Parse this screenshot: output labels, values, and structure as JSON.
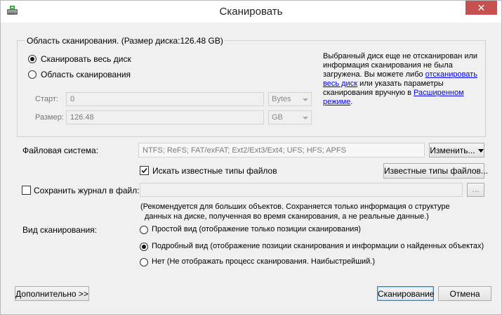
{
  "window": {
    "title": "Сканировать",
    "close_glyph": "✕"
  },
  "scan_area": {
    "group_title": "Область сканирования. (Размер диска:126.48 GB)",
    "radio_whole_disk": "Сканировать весь диск",
    "radio_area": "Область сканирования",
    "start_label": "Старт:",
    "start_value": "0",
    "start_unit": "Bytes",
    "size_label": "Размер:",
    "size_value": "126.48",
    "size_unit": "GB",
    "info_part1": "Выбранный диск еще не отсканирован или информация сканирования не была загружена. Вы можете либо ",
    "info_link1": "отсканировать весь диск",
    "info_part2": " или указать параметры сканирования вручную в ",
    "info_link2": "Расширенном режиме",
    "info_part3": "."
  },
  "filesystem": {
    "label": "Файловая система:",
    "value": "NTFS; ReFS; FAT/exFAT; Ext2/Ext3/Ext4; UFS; HFS; APFS",
    "change_button": "Изменить..."
  },
  "known_types": {
    "checkbox_label": "Искать известные типы файлов",
    "checked": true,
    "button": "Известные типы файлов..."
  },
  "log": {
    "checkbox_label": "Сохранить журнал в файл:",
    "checked": false,
    "path_value": "",
    "browse_button": "...",
    "note_line1": "(Рекомендуется для больших объектов. Сохраняется только информация о структуре",
    "note_line2": "данных на диске, полученная во время сканирования, а не реальные данные.)"
  },
  "scan_view": {
    "label": "Вид сканирования:",
    "options": [
      "Простой вид (отображение только позиции сканирования)",
      "Подробный вид (отображение позиции сканирования и информации о найденных объектах)",
      "Нет (Не отображать процесс сканирования. Наибыстрейший.)"
    ],
    "selected_index": 1
  },
  "footer": {
    "advanced_button": "Дополнительно >>",
    "scan_button": "Сканирование",
    "cancel_button": "Отмена"
  },
  "icons": {
    "app": "disk-scan-icon",
    "close": "close-icon",
    "dropdown": "chevron-down-icon"
  }
}
